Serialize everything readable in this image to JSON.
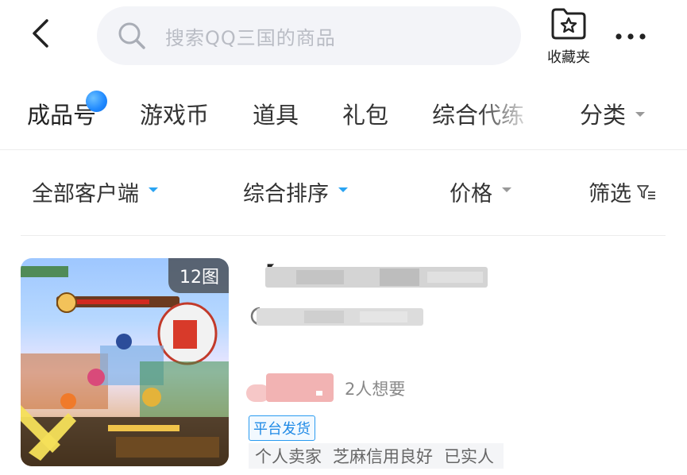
{
  "header": {
    "search_placeholder": "搜索QQ三国的商品",
    "favorites_label": "收藏夹"
  },
  "tabs": [
    {
      "label": "成品号",
      "active": true
    },
    {
      "label": "游戏币"
    },
    {
      "label": "道具"
    },
    {
      "label": "礼包"
    },
    {
      "label": "综合代练"
    },
    {
      "label": "分类"
    }
  ],
  "filters": {
    "client": "全部客户端",
    "sort": "综合排序",
    "price": "价格",
    "screen": "筛选"
  },
  "product": {
    "image_count": "12图",
    "title_prefix": "【",
    "want_count": "2人想要",
    "badge": "平台发货",
    "tags": [
      "个人卖家",
      "芝麻信用良好",
      "已实人"
    ]
  },
  "colors": {
    "accent": "#2aa4f2",
    "badge_blue": "#1f8ae6",
    "dot_blue": "#1e88ff"
  },
  "icons": [
    "back-arrow-icon",
    "search-icon",
    "star-folder-icon",
    "more-dots-icon",
    "filter-funnel-icon"
  ]
}
